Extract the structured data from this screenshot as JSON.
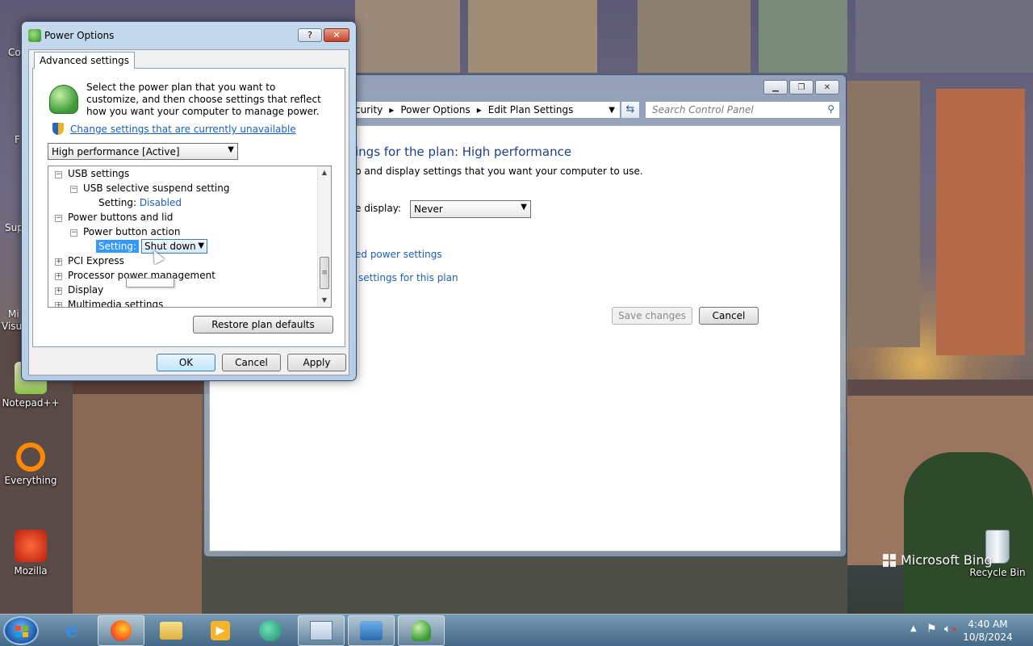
{
  "desktop": {
    "icons": [
      {
        "label": "Notepad++"
      },
      {
        "label": "Everything"
      },
      {
        "label": "Mozilla"
      },
      {
        "label": "Recycle Bin"
      }
    ],
    "edge_labels": [
      "Co",
      "F",
      "Sup",
      "Mi",
      "Visu"
    ],
    "watermark": "Microsoft Bing"
  },
  "control_panel": {
    "breadcrumb": [
      "curity",
      "Power Options",
      "Edit Plan Settings"
    ],
    "search_placeholder": "Search Control Panel",
    "heading": "ings for the plan: High performance",
    "subtext": "p and display settings that you want your computer to use.",
    "display_label": "e display:",
    "display_value": "Never",
    "link_advanced": "ed power settings",
    "link_restore": "settings for this plan",
    "save_label": "Save changes",
    "cancel_label": "Cancel"
  },
  "power_dialog": {
    "title": "Power Options",
    "help_glyph": "?",
    "close_glyph": "✕",
    "tab": "Advanced settings",
    "intro": "Select the power plan that you want to customize, and then choose settings that reflect how you want your computer to manage power.",
    "change_link": "Change settings that are currently unavailable",
    "plan_selected": "High performance [Active]",
    "tree": {
      "usb": "USB settings",
      "usb_suspend": "USB selective suspend setting",
      "setting_label": "Setting:",
      "usb_value": "Disabled",
      "power_buttons": "Power buttons and lid",
      "power_button_action": "Power button action",
      "power_action_value": "Shut down",
      "pci": "PCI Express",
      "processor": "Processor power management",
      "display": "Display",
      "multimedia": "Multimedia settings"
    },
    "restore_label": "Restore plan defaults",
    "ok_label": "OK",
    "cancel_label": "Cancel",
    "apply_label": "Apply"
  },
  "taskbar": {
    "time": "4:40 AM",
    "date": "10/8/2024"
  }
}
